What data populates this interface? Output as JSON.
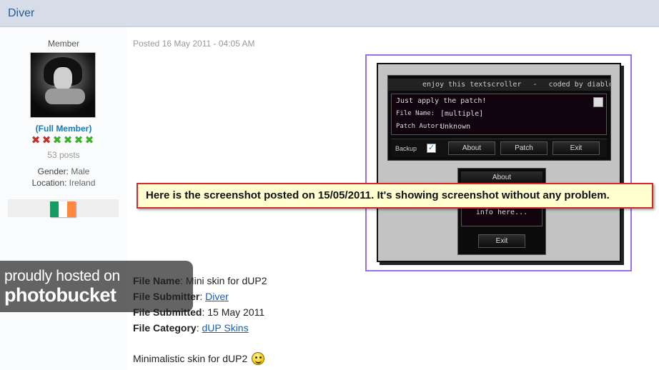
{
  "header": {
    "author_name": "Diver"
  },
  "profile": {
    "role": "Member",
    "group": "(Full Member)",
    "pips": [
      "red",
      "red",
      "green",
      "green",
      "green",
      "green"
    ],
    "posts": "53 posts",
    "gender_label": "Gender:",
    "gender_value": "Male",
    "location_label": "Location:",
    "location_value": "Ireland",
    "flag_colors": [
      "#169b62",
      "#ffffff",
      "#ff883e"
    ]
  },
  "post": {
    "posted": "Posted 16 May 2011 - 04:05 AM",
    "screenshot": {
      "scroller_text": [
        "enjoy this textscroller",
        "-",
        "coded by diablo"
      ],
      "log_line1": "Just apply the patch!",
      "file_name_label": "File Name:",
      "file_name_value": "[multiple]",
      "patch_autor_label": "Patch Autor:",
      "patch_autor_value": "Unknown",
      "backup_label": "Backup",
      "btn_about": "About",
      "btn_patch": "Patch",
      "btn_exit": "Exit",
      "about_title": "About",
      "about_text": "info here...",
      "about_exit": "Exit"
    },
    "callout": "Here is the screenshot posted on 15/05/2011. It's showing screenshot without any problem.",
    "watermark_line1": "proudly hosted on",
    "watermark_line2": "photobucket",
    "details": {
      "file_name_label": "File Name",
      "file_name_value": ": Mini skin for dUP2",
      "submitter_label": "File Submitter",
      "submitter_sep": ": ",
      "submitter_value": "Diver",
      "submitted_label": "File Submitted",
      "submitted_value": ": 15 May 2011",
      "category_label": "File Category",
      "category_sep": ": ",
      "category_value": "dUP Skins"
    },
    "description": "Minimalistic skin for dUP2"
  }
}
